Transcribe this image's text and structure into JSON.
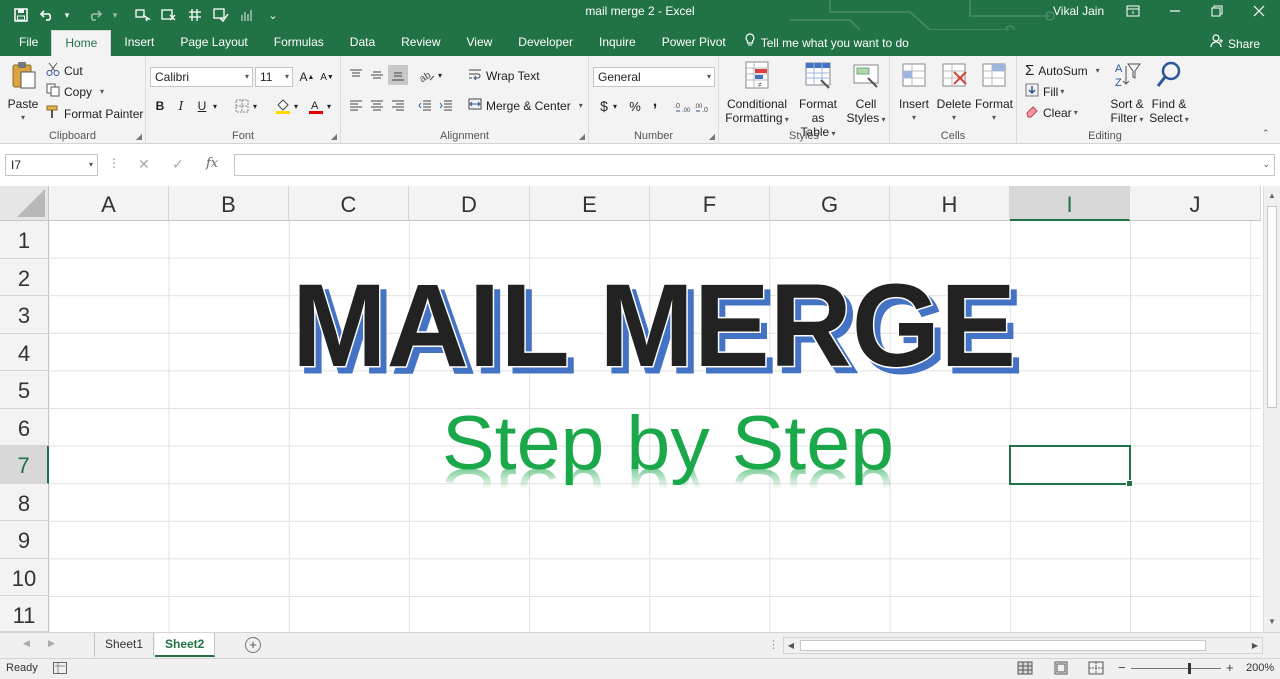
{
  "app": {
    "window_title": "mail merge 2 - Excel",
    "user_name": "Vikal Jain"
  },
  "quick_access": [
    "save-icon",
    "undo-icon",
    "redo-icon",
    "touch-mode-icon",
    "clear-formats-icon",
    "table-icon",
    "check-icon",
    "chart-icon"
  ],
  "tabs": [
    "File",
    "Home",
    "Insert",
    "Page Layout",
    "Formulas",
    "Data",
    "Review",
    "View",
    "Developer",
    "Inquire",
    "Power Pivot"
  ],
  "active_tab": "Home",
  "tell_me": "Tell me what you want to do",
  "share_label": "Share",
  "ribbon": {
    "clipboard": {
      "label": "Clipboard",
      "paste": "Paste",
      "cut": "Cut",
      "copy": "Copy",
      "format_painter": "Format Painter"
    },
    "font": {
      "label": "Font",
      "font_name": "Calibri",
      "font_size": "11",
      "bold": "B",
      "italic": "I",
      "underline": "U"
    },
    "alignment": {
      "label": "Alignment",
      "wrap_text": "Wrap Text",
      "merge_center": "Merge & Center"
    },
    "number": {
      "label": "Number",
      "format": "General",
      "currency": "$",
      "percent": "%",
      "comma": ","
    },
    "styles": {
      "label": "Styles",
      "conditional_formatting_line1": "Conditional",
      "conditional_formatting_line2": "Formatting",
      "format_as_table_line1": "Format as",
      "format_as_table_line2": "Table",
      "cell_styles_line1": "Cell",
      "cell_styles_line2": "Styles"
    },
    "cells": {
      "label": "Cells",
      "insert": "Insert",
      "delete": "Delete",
      "format": "Format"
    },
    "editing": {
      "label": "Editing",
      "autosum": "AutoSum",
      "fill": "Fill",
      "clear": "Clear",
      "sort_filter_line1": "Sort &",
      "sort_filter_line2": "Filter",
      "find_select_line1": "Find &",
      "find_select_line2": "Select"
    }
  },
  "formula_bar": {
    "name_box": "I7",
    "formula": ""
  },
  "grid": {
    "columns": [
      "A",
      "B",
      "C",
      "D",
      "E",
      "F",
      "G",
      "H",
      "I",
      "J"
    ],
    "rows": [
      "1",
      "2",
      "3",
      "4",
      "5",
      "6",
      "7",
      "8",
      "9",
      "10",
      "11"
    ],
    "selected_column": "I",
    "selected_row": "7"
  },
  "wordart": {
    "title": "MAIL MERGE",
    "subtitle": "Step by Step",
    "title_color": "#222222",
    "title_shadow": "#4472c4",
    "subtitle_color": "#1aa84b"
  },
  "sheets": [
    "Sheet1",
    "Sheet2"
  ],
  "active_sheet": "Sheet2",
  "status": {
    "ready": "Ready",
    "zoom": "200%"
  },
  "colors": {
    "excel_green": "#217346",
    "ribbon_bg": "#f3f3f3"
  }
}
